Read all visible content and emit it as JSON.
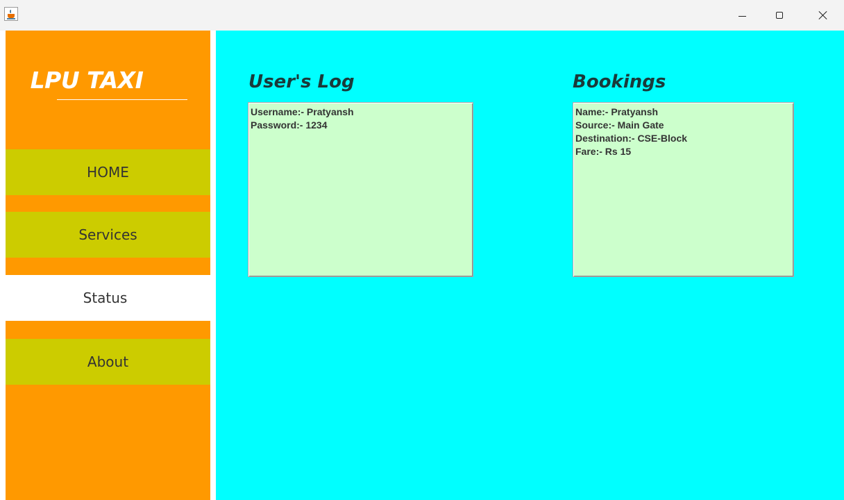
{
  "window": {
    "title": "",
    "app_icon": "java-cup-icon",
    "controls": {
      "minimize_icon": "minimize-icon",
      "maximize_icon": "maximize-icon",
      "close_icon": "close-icon"
    }
  },
  "sidebar": {
    "brand": "LPU TAXI",
    "items": [
      {
        "label": "HOME",
        "active": false
      },
      {
        "label": "Services",
        "active": false
      },
      {
        "label": "Status",
        "active": true
      },
      {
        "label": "About",
        "active": false
      }
    ]
  },
  "main": {
    "users_log": {
      "title": "User's Log",
      "lines": [
        "Username:- Pratyansh",
        "Password:- 1234"
      ]
    },
    "bookings": {
      "title": "Bookings",
      "lines": [
        "Name:- Pratyansh",
        "Source:- Main Gate",
        "Destination:- CSE-Block",
        "Fare:- Rs 15"
      ]
    }
  },
  "colors": {
    "sidebar_bg": "#ff9900",
    "nav_item_bg": "#cccc00",
    "nav_active_bg": "#ffffff",
    "content_bg": "#00ffff",
    "panel_bg": "#ccffcc",
    "title_text": "#1a3a3a"
  }
}
